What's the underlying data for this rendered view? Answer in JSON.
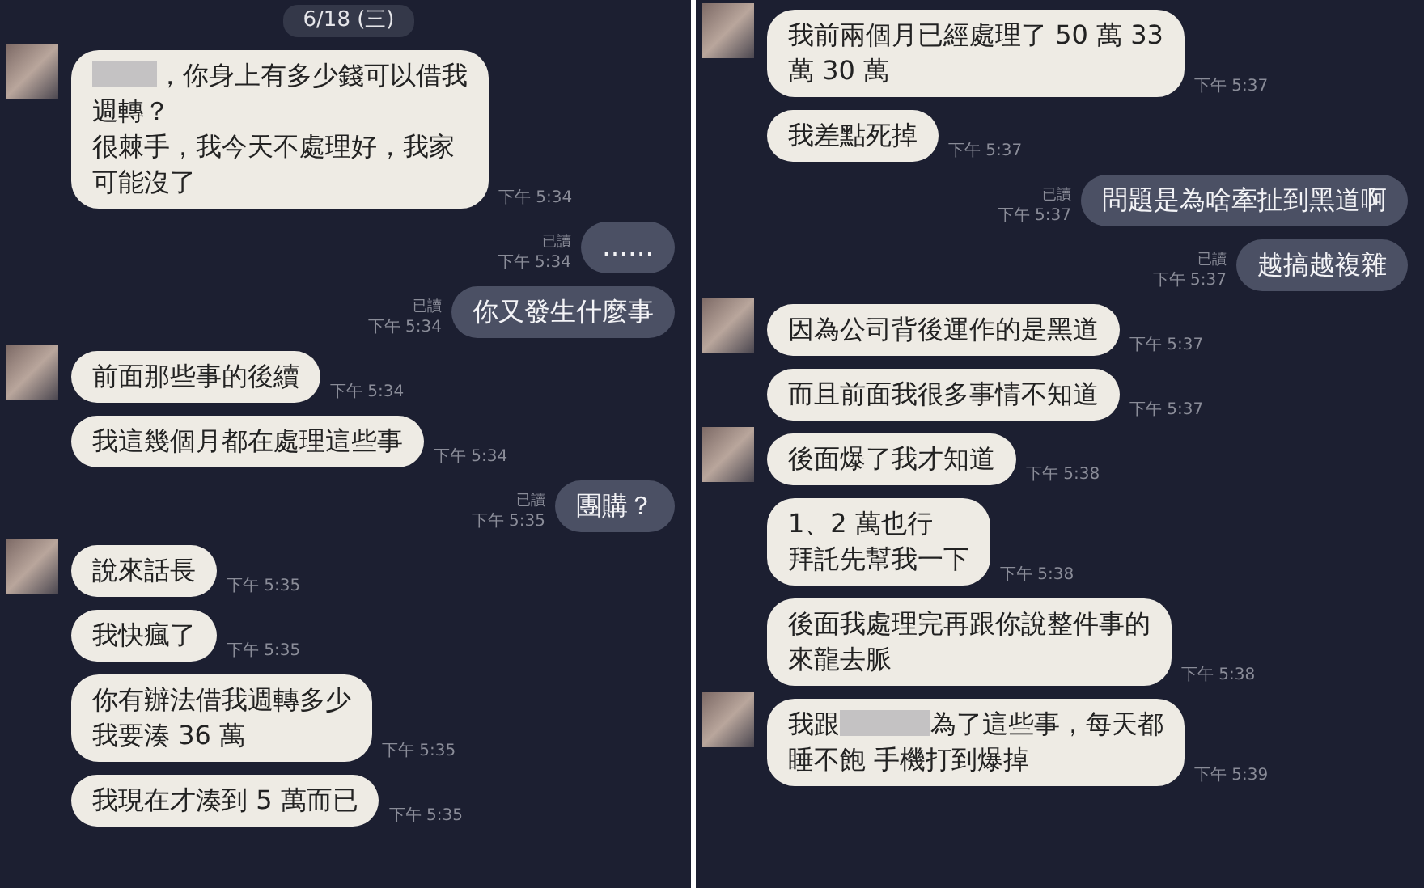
{
  "panels": [
    {
      "date": "6/18 (三)",
      "messages": [
        {
          "kind": "incoming",
          "avatar": true,
          "lines": [
            [
              {
                "kind": "redacted"
              },
              {
                "kind": "text",
                "text": "，你身上有多少錢可以借我"
              }
            ],
            [
              {
                "kind": "text",
                "text": "週轉？"
              }
            ],
            [
              {
                "kind": "text",
                "text": "很棘手，我今天不處理好，我家"
              }
            ],
            [
              {
                "kind": "text",
                "text": "可能沒了"
              }
            ]
          ],
          "time": "下午 5:34"
        },
        {
          "kind": "outgoing",
          "read": "已讀",
          "lines": [
            [
              {
                "kind": "text",
                "text": "……"
              }
            ]
          ],
          "time": "下午 5:34"
        },
        {
          "kind": "outgoing",
          "read": "已讀",
          "lines": [
            [
              {
                "kind": "text",
                "text": "你又發生什麼事"
              }
            ]
          ],
          "time": "下午 5:34"
        },
        {
          "kind": "incoming",
          "avatar": true,
          "lines": [
            [
              {
                "kind": "text",
                "text": "前面那些事的後續"
              }
            ]
          ],
          "time": "下午 5:34"
        },
        {
          "kind": "incoming",
          "avatar": false,
          "lines": [
            [
              {
                "kind": "text",
                "text": "我這幾個月都在處理這些事"
              }
            ]
          ],
          "time": "下午 5:34"
        },
        {
          "kind": "outgoing",
          "read": "已讀",
          "lines": [
            [
              {
                "kind": "text",
                "text": "團購？"
              }
            ]
          ],
          "time": "下午 5:35"
        },
        {
          "kind": "incoming",
          "avatar": true,
          "lines": [
            [
              {
                "kind": "text",
                "text": "說來話長"
              }
            ]
          ],
          "time": "下午 5:35"
        },
        {
          "kind": "incoming",
          "avatar": false,
          "lines": [
            [
              {
                "kind": "text",
                "text": "我快瘋了"
              }
            ]
          ],
          "time": "下午 5:35"
        },
        {
          "kind": "incoming",
          "avatar": false,
          "lines": [
            [
              {
                "kind": "text",
                "text": "你有辦法借我週轉多少"
              }
            ],
            [
              {
                "kind": "text",
                "text": "我要湊 36 萬"
              }
            ]
          ],
          "time": "下午 5:35"
        },
        {
          "kind": "incoming",
          "avatar": false,
          "lines": [
            [
              {
                "kind": "text",
                "text": "我現在才湊到 5 萬而已"
              }
            ]
          ],
          "time": "下午 5:35"
        }
      ]
    },
    {
      "messages": [
        {
          "kind": "incoming",
          "avatar": true,
          "lines": [
            [
              {
                "kind": "text",
                "text": "我前兩個月已經處理了 50 萬 33"
              }
            ],
            [
              {
                "kind": "text",
                "text": "萬 30 萬"
              }
            ]
          ],
          "time": "下午 5:37"
        },
        {
          "kind": "incoming",
          "avatar": false,
          "lines": [
            [
              {
                "kind": "text",
                "text": "我差點死掉"
              }
            ]
          ],
          "time": "下午 5:37"
        },
        {
          "kind": "outgoing",
          "read": "已讀",
          "lines": [
            [
              {
                "kind": "text",
                "text": "問題是為啥牽扯到黑道啊"
              }
            ]
          ],
          "time": "下午 5:37"
        },
        {
          "kind": "outgoing",
          "read": "已讀",
          "lines": [
            [
              {
                "kind": "text",
                "text": "越搞越複雜"
              }
            ]
          ],
          "time": "下午 5:37"
        },
        {
          "kind": "incoming",
          "avatar": true,
          "lines": [
            [
              {
                "kind": "text",
                "text": "因為公司背後運作的是黑道"
              }
            ]
          ],
          "time": "下午 5:37"
        },
        {
          "kind": "incoming",
          "avatar": false,
          "lines": [
            [
              {
                "kind": "text",
                "text": "而且前面我很多事情不知道"
              }
            ]
          ],
          "time": "下午 5:37"
        },
        {
          "kind": "incoming",
          "avatar": true,
          "lines": [
            [
              {
                "kind": "text",
                "text": "後面爆了我才知道"
              }
            ]
          ],
          "time": "下午 5:38"
        },
        {
          "kind": "incoming",
          "avatar": false,
          "lines": [
            [
              {
                "kind": "text",
                "text": "1、2 萬也行"
              }
            ],
            [
              {
                "kind": "text",
                "text": "拜託先幫我一下"
              }
            ]
          ],
          "time": "下午 5:38"
        },
        {
          "kind": "incoming",
          "avatar": false,
          "lines": [
            [
              {
                "kind": "text",
                "text": "後面我處理完再跟你說整件事的"
              }
            ],
            [
              {
                "kind": "text",
                "text": "來龍去脈"
              }
            ]
          ],
          "time": "下午 5:38"
        },
        {
          "kind": "incoming",
          "avatar": true,
          "lines": [
            [
              {
                "kind": "text",
                "text": "我跟"
              },
              {
                "kind": "redacted"
              },
              {
                "kind": "text",
                "text": "為了這些事，每天都"
              }
            ],
            [
              {
                "kind": "text",
                "text": "睡不飽 手機打到爆掉"
              }
            ]
          ],
          "time": "下午 5:39"
        }
      ]
    }
  ]
}
